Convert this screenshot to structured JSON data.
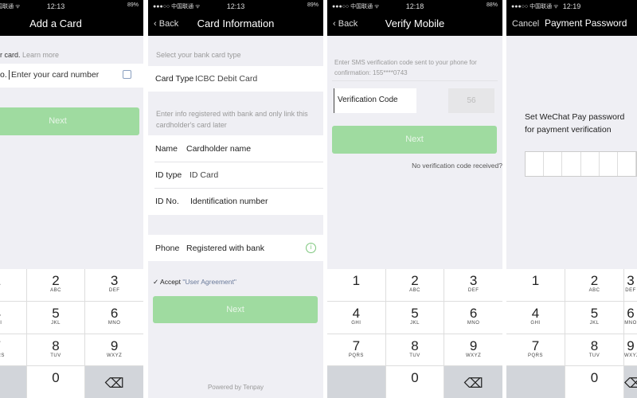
{
  "keypad": [
    {
      "d": "1",
      "l": ""
    },
    {
      "d": "2",
      "l": "ABC"
    },
    {
      "d": "3",
      "l": "DEF"
    },
    {
      "d": "4",
      "l": "GHI"
    },
    {
      "d": "5",
      "l": "JKL"
    },
    {
      "d": "6",
      "l": "MNO"
    },
    {
      "d": "7",
      "l": "PQRS"
    },
    {
      "d": "8",
      "l": "TUV"
    },
    {
      "d": "9",
      "l": "WXYZ"
    },
    {
      "d": "",
      "l": ""
    },
    {
      "d": "0",
      "l": ""
    },
    {
      "d": "⌫",
      "l": ""
    }
  ],
  "screens": [
    {
      "status": {
        "carrier": "●●●○○ 中国联通 ᯤ",
        "time": "12:13",
        "battery": "89%"
      },
      "title": "Add a Card",
      "intro": "r card.",
      "learn_more": "Learn more",
      "field_label": "o.",
      "placeholder": "Enter your card number",
      "next": "Next"
    },
    {
      "status": {
        "carrier": "●●●○○ 中国联通 ᯤ",
        "time": "12:13",
        "battery": "89%"
      },
      "back": "Back",
      "title": "Card Information",
      "select_hint": "Select your bank card type",
      "card_type_label": "Card Type",
      "card_type_value": "ICBC Debit Card",
      "info_hint": "Enter info registered with bank and only link this cardholder's card later",
      "name_label": "Name",
      "name_placeholder": "Cardholder name",
      "idtype_label": "ID type",
      "idtype_value": "ID Card",
      "idno_label": "ID No.",
      "idno_placeholder": "Identification number",
      "phone_label": "Phone",
      "phone_placeholder": "Registered with bank",
      "accept": "Accept",
      "agreement": "\"User Agreement\"",
      "next": "Next",
      "powered": "Powered by Tenpay"
    },
    {
      "status": {
        "carrier": "●●●○○ 中国联通 ᯤ",
        "time": "12:18",
        "battery": "88%"
      },
      "back": "Back",
      "title": "Verify Mobile",
      "hint": "Enter SMS verification code sent to your phone for confirmation: 155****0743",
      "code_placeholder": "Verification Code",
      "countdown": "56",
      "next": "Next",
      "no_code": "No verification code received?"
    },
    {
      "status": {
        "carrier": "●●●○○ 中国联通 ᯤ",
        "time": "12:19",
        "battery": ""
      },
      "cancel": "Cancel",
      "title": "Payment Password",
      "prompt": "Set WeChat Pay password for payment verification"
    }
  ],
  "colors": {
    "accent": "#9fdba0",
    "navbar": "#000000",
    "background": "#efeff4"
  }
}
